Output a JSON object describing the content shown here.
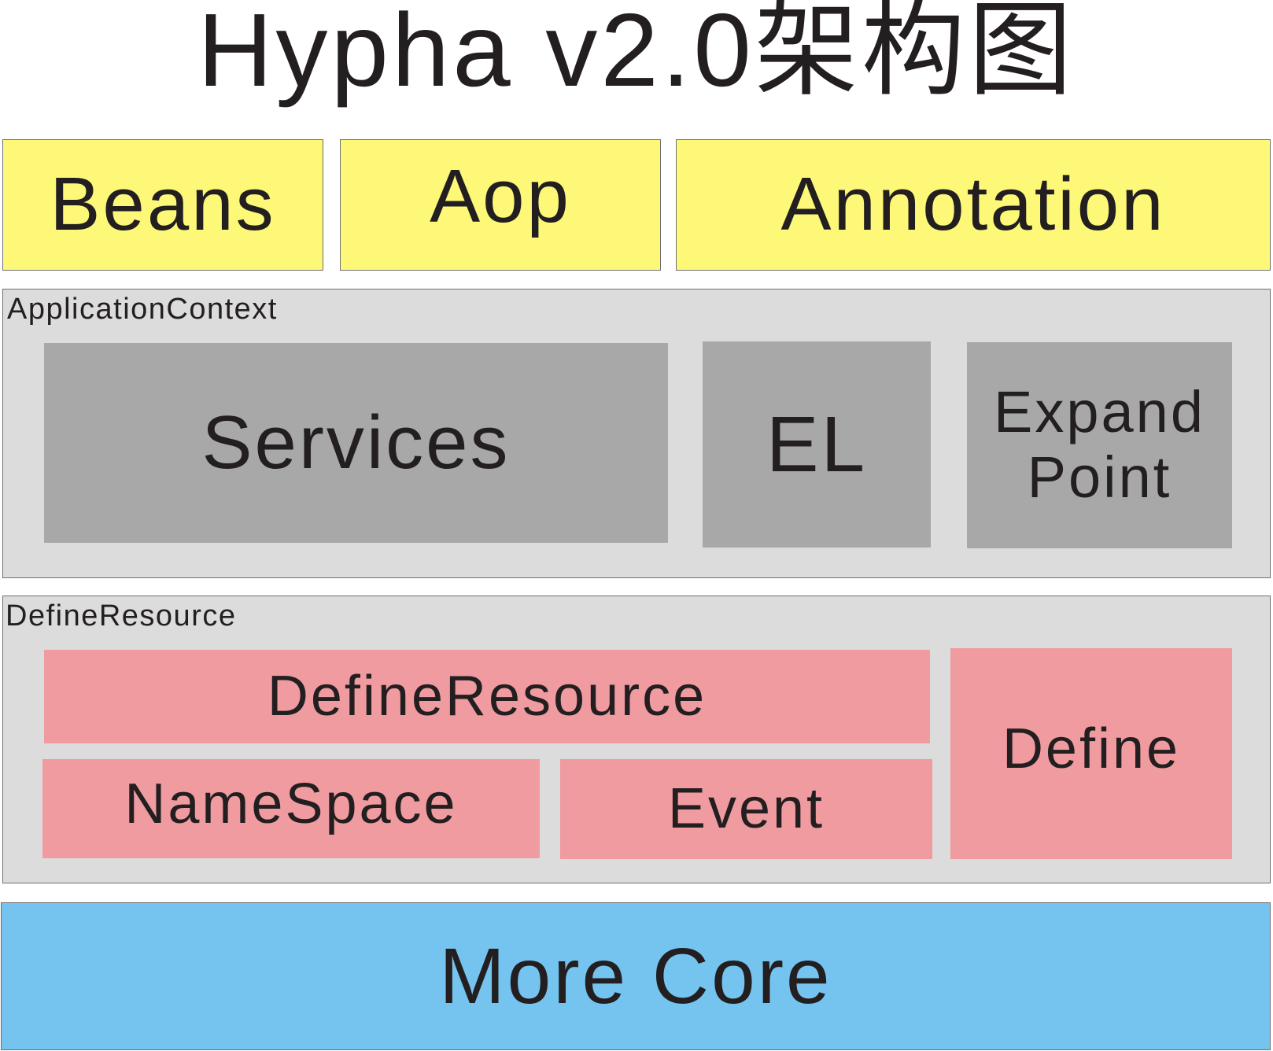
{
  "title": "Hypha v2.0架构图",
  "top_row": {
    "beans": "Beans",
    "aop": "Aop",
    "annotation": "Annotation"
  },
  "application_context": {
    "label": "ApplicationContext",
    "services": "Services",
    "el": "EL",
    "expand_point_line1": "Expand",
    "expand_point_line2": "Point"
  },
  "define_resource_layer": {
    "label": "DefineResource",
    "define_resource": "DefineResource",
    "namespace": "NameSpace",
    "event": "Event",
    "define": "Define"
  },
  "core": {
    "label": "More Core"
  },
  "colors": {
    "top_row": "#fdf877",
    "panel": "#dcdcdc",
    "application_context_boxes": "#a8a8a8",
    "define_resource_boxes": "#ef9ba0",
    "core": "#75c3ef"
  }
}
